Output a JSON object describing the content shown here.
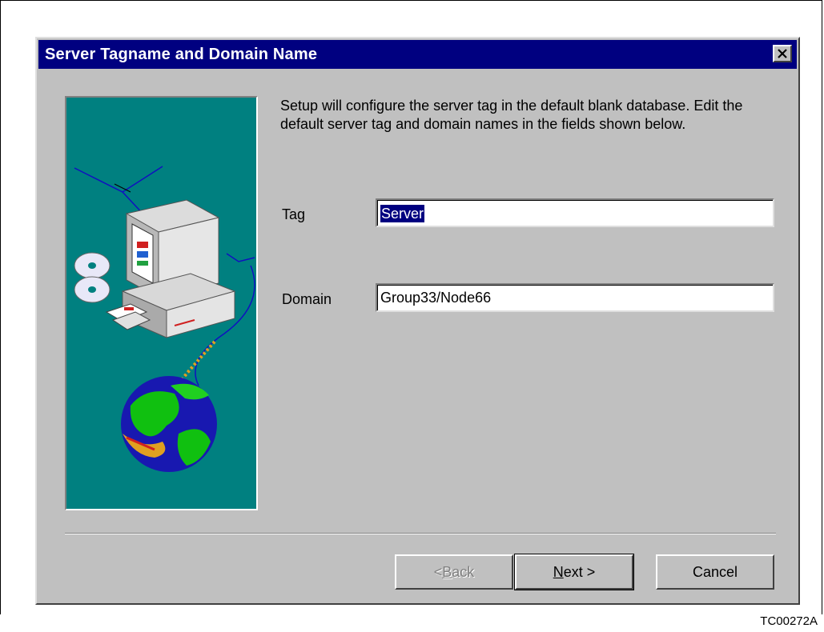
{
  "dialog": {
    "title": "Server Tagname and Domain Name",
    "instructions": "Setup will configure the server tag in the default blank database. Edit the default server tag and domain names in the fields shown below."
  },
  "fields": {
    "tag": {
      "label": "Tag",
      "value": "Server"
    },
    "domain": {
      "label": "Domain",
      "value": "Group33/Node66"
    }
  },
  "buttons": {
    "back": {
      "mnemonic": "B",
      "rest": "ack",
      "prefix": "< ",
      "enabled": false
    },
    "next": {
      "mnemonic": "N",
      "rest": "ext >",
      "prefix": "",
      "enabled": true,
      "default": true
    },
    "cancel": {
      "label": "Cancel",
      "enabled": true
    }
  },
  "figure_id": "TC00272A",
  "icons": {
    "close": "close-icon",
    "illustration": "setup-illustration"
  },
  "colors": {
    "title_bar": "#000080",
    "dialog_face": "#c0c0c0",
    "illustration_bg": "#008080",
    "selection": "#000080"
  }
}
